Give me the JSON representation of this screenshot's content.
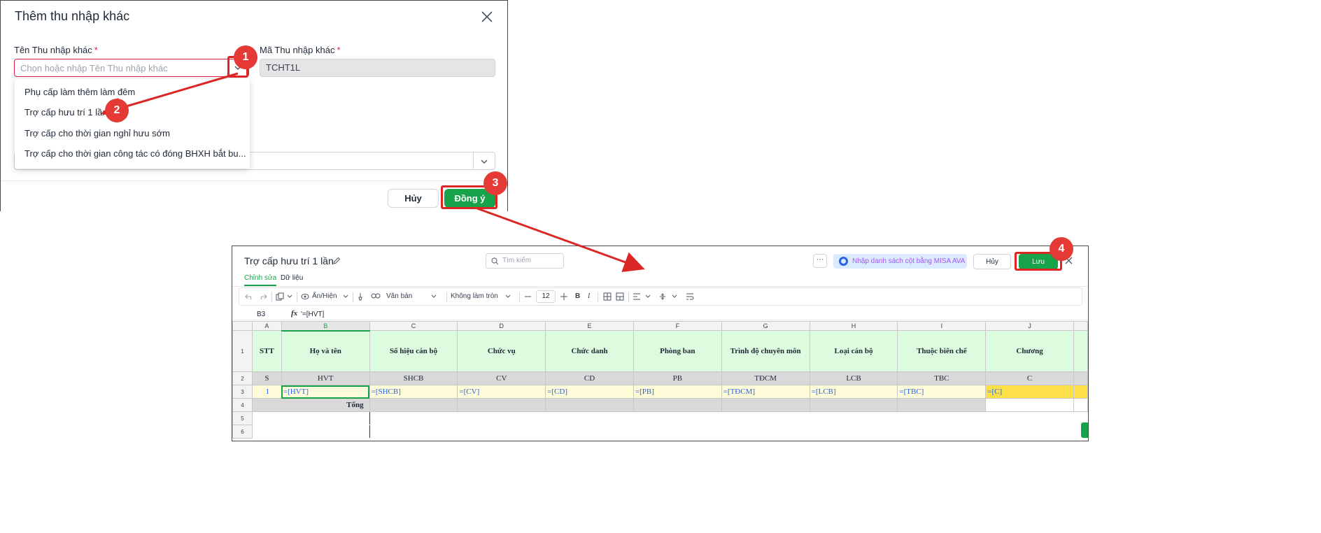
{
  "dialog": {
    "title": "Thêm thu nhập khác",
    "name_label": "Tên Thu nhập khác",
    "required_mark": "*",
    "name_placeholder": "Chọn hoặc nhập Tên Thu nhập khác",
    "code_label": "Mã Thu nhập khác",
    "code_value": "TCHT1L",
    "dropdown_items": [
      "Phụ cấp làm thêm làm đêm",
      "Trợ cấp hưu trí 1 lần",
      "Trợ cấp cho thời gian nghỉ hưu sớm",
      "Trợ cấp cho thời gian công tác có đóng BHXH bắt bu..."
    ],
    "cancel_label": "Hủy",
    "ok_label": "Đồng ý"
  },
  "markers": [
    "1",
    "2",
    "3",
    "4"
  ],
  "sheet": {
    "title": "Trợ cấp hưu trí 1 lần",
    "search_placeholder": "Tìm kiếm",
    "more_label": "···",
    "ava_label": "Nhập danh sách cột bằng MISA AVA",
    "cancel_label": "Hủy",
    "save_label": "Lưu",
    "tabs": [
      "Chỉnh sửa",
      "Dữ liệu"
    ],
    "toolbar": {
      "show_hide": "Ẩn/Hiện",
      "format": "Văn bản",
      "rounding": "Không làm tròn",
      "font_size": "12",
      "bold": "B",
      "italic": "I"
    },
    "cell_ref": "B3",
    "formula": "'=[HVT]",
    "columns": [
      "A",
      "B",
      "C",
      "D",
      "E",
      "F",
      "G",
      "H",
      "I",
      "J"
    ],
    "rows": [
      "1",
      "2",
      "3",
      "4",
      "5",
      "6"
    ],
    "headers": [
      "STT",
      "Họ và tên",
      "Số hiệu cán bộ",
      "Chức vụ",
      "Chức danh",
      "Phòng ban",
      "Trình độ chuyên môn",
      "Loại cán bộ",
      "Thuộc biên chế",
      "Chương"
    ],
    "codes": [
      "S",
      "HVT",
      "SHCB",
      "CV",
      "CD",
      "PB",
      "TĐCM",
      "LCB",
      "TBC",
      "C"
    ],
    "formulas": [
      "1",
      "=[HVT]",
      "=[SHCB]",
      "=[CV]",
      "=[CD]",
      "=[PB]",
      "=[TĐCM]",
      "=[LCB]",
      "=[TBC]",
      "=[C]"
    ],
    "total_label": "Tổng"
  },
  "colors": {
    "primary_green": "#16a34a",
    "annotation_red": "#dc2626",
    "header_fill": "#ddfbdf",
    "formula_fill": "#fefbd8",
    "highlight_yellow": "#fde047"
  }
}
